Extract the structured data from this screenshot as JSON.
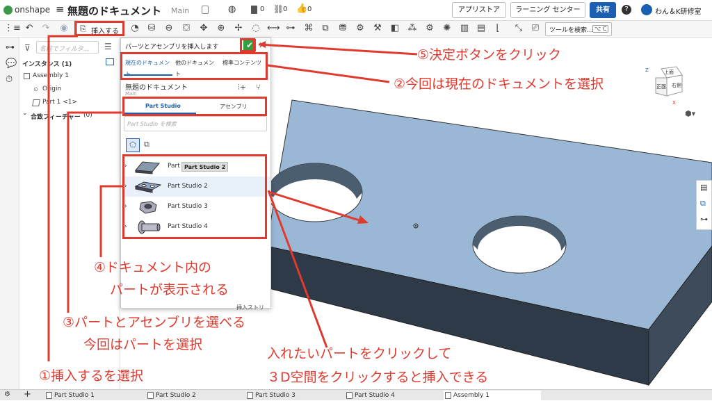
{
  "topbar": {
    "brand": "onshape",
    "doc_title": "無題のドキュメント",
    "branch": "Main",
    "counts": {
      "versions": "0",
      "links": "0",
      "likes": "0"
    },
    "app_store": "アプリストア",
    "learning_center": "ラーニング センター",
    "share": "共有",
    "user": "わん＆K研修室"
  },
  "toolbar": {
    "insert_label": "挿入する",
    "search_tools": "ツールを検索...",
    "shortcut": "⌥ C"
  },
  "features": {
    "filter_placeholder": "名前でフィルタ...",
    "instances_header": "インスタンス (1)",
    "assembly": "Assembly 1",
    "origin": "Origin",
    "part": "Part 1 <1>",
    "mates_header": "合致フィーチャー",
    "mates_count": "(0)"
  },
  "dialog": {
    "title": "パーツとアセンブリを挿入します",
    "tabs": [
      "現在のドキュメント",
      "他のドキュメント",
      "標準コンテンツ"
    ],
    "doc_name": "無題のドキュメント",
    "branch": "Main",
    "subtabs": [
      "Part Studio",
      "アセンブリ"
    ],
    "search_placeholder": "Part Studio を検索",
    "parts": [
      "Part Studio 1",
      "Part Studio 2",
      "Part Studio 3",
      "Part Studio 4"
    ],
    "part1_truncated": "Part",
    "tooltip": "Part Studio 2",
    "footer": "挿入ストリ"
  },
  "bottom_tabs": [
    "Part Studio 1",
    "Part Studio 2",
    "Part Studio 3",
    "Part Studio 4",
    "Assembly 1"
  ],
  "annotations": {
    "a1": "①挿入するを選択",
    "a2": "②今回は現在のドキュメントを選択",
    "a3_line1": "③パートとアセンブリを選べる",
    "a3_line2": "今回はパートを選択",
    "a4_line1": "④ドキュメント内の",
    "a4_line2": "パートが表示される",
    "a5": "⑤決定ボタンをクリック",
    "a6_line1": "入れたいパートをクリックして",
    "a6_line2": "３D空間をクリックすると挿入できる"
  },
  "viewcube": {
    "top": "上面",
    "front": "正面",
    "right": "右側",
    "x": "X",
    "z": "Z"
  },
  "colors": {
    "annotation": "#e03a2f",
    "accent": "#1b5fb0",
    "part_face": "#9ab8d6",
    "confirm": "#2e9e3e"
  }
}
